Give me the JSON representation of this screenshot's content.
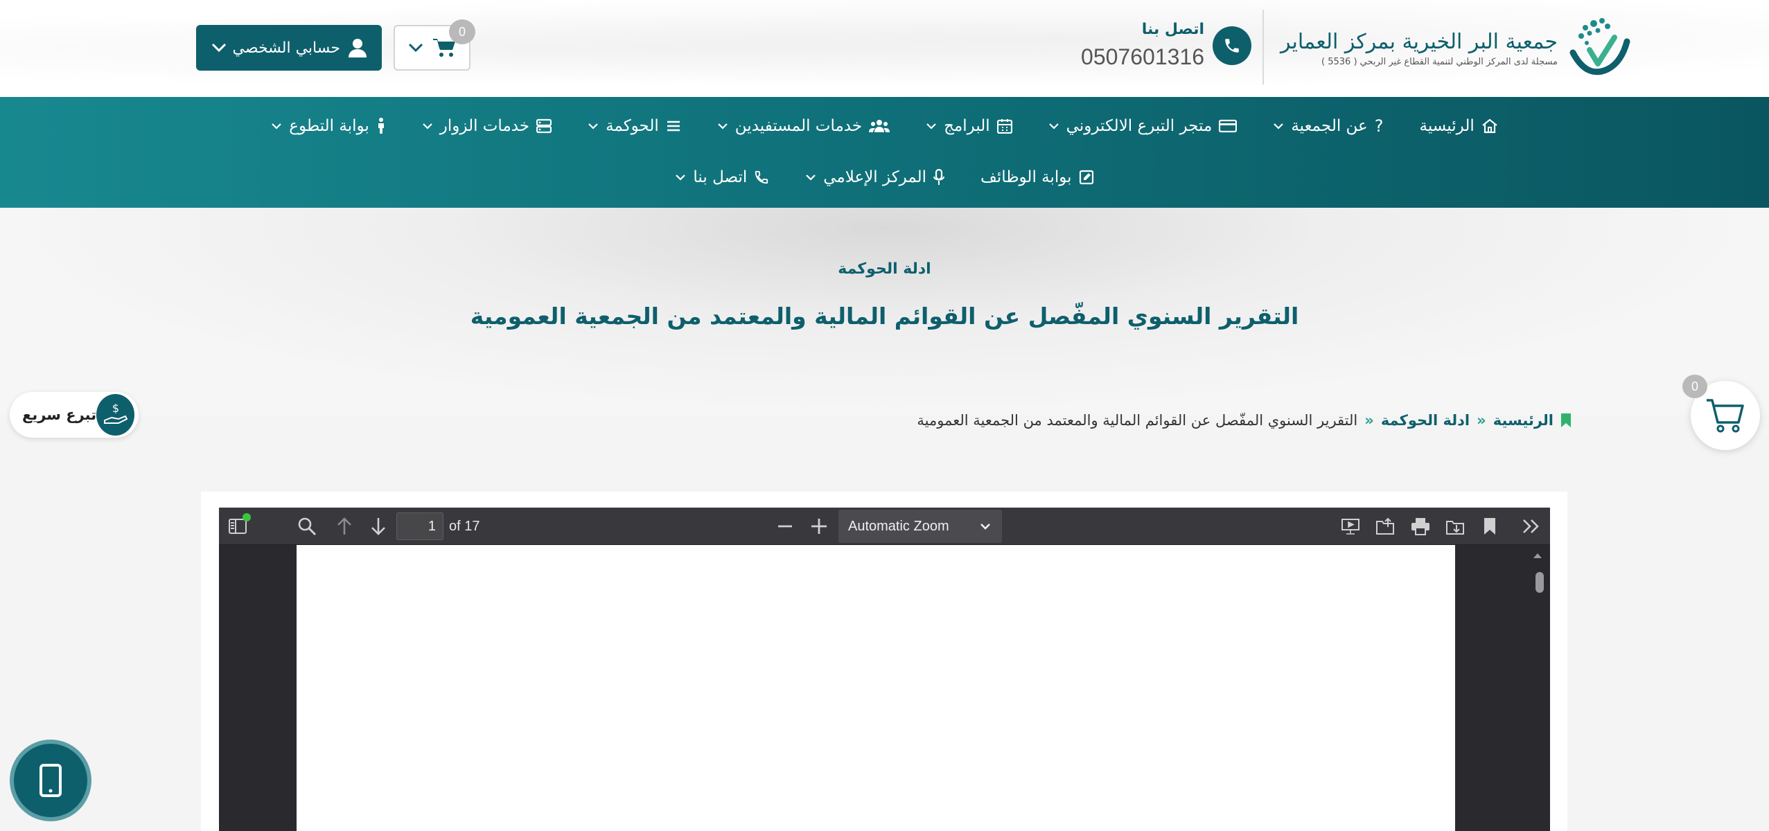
{
  "header": {
    "logo": {
      "title": "جمعية البر الخيرية بمركز العماير",
      "subtitle": "مسجلة لدى المركز الوطني لتنمية القطاع غير الربحي ( 5536 )"
    },
    "contact": {
      "label": "اتصل بنا",
      "phone": "0507601316"
    },
    "account_label": "حسابي الشخصي",
    "cart_count": "0"
  },
  "nav": {
    "row1": [
      {
        "label": "الرئيسية",
        "icon": "home-icon"
      },
      {
        "label": "عن الجمعية",
        "icon": "question-icon"
      },
      {
        "label": "متجر التبرع الالكتروني",
        "icon": "card-icon"
      },
      {
        "label": "البرامج",
        "icon": "calendar-icon"
      },
      {
        "label": "خدمات المستفيدين",
        "icon": "users-icon"
      },
      {
        "label": "الحوكمة",
        "icon": "list-icon"
      },
      {
        "label": "خدمات الزوار",
        "icon": "server-icon"
      },
      {
        "label": "بوابة التطوع",
        "icon": "person-icon"
      }
    ],
    "row2": [
      {
        "label": "بوابة الوظائف",
        "icon": "edit-icon"
      },
      {
        "label": "المركز الإعلامي",
        "icon": "mic-icon"
      },
      {
        "label": "اتصل بنا",
        "icon": "phone-icon"
      }
    ]
  },
  "hero": {
    "subtitle": "ادلة الحوكمة",
    "title": "التقرير السنوي المفّصل عن القوائم المالية والمعتمد من الجمعية العمومية"
  },
  "breadcrumb": {
    "home": "الرئيسية",
    "separator": "»",
    "section": "ادلة الحوكمة",
    "current": "التقرير السنوي المفّصل عن القوائم المالية والمعتمد من الجمعية العمومية"
  },
  "quick_donate": {
    "label": "تبرع سريع"
  },
  "floating_cart": {
    "count": "0"
  },
  "pdf_viewer": {
    "page_number": "1",
    "page_total": "of 17",
    "zoom": "Automatic Zoom"
  },
  "colors": {
    "brand": "#0e5f6c",
    "nav_start": "#18888f",
    "nav_end": "#0a5660",
    "accent_green": "#2a9d8f"
  }
}
